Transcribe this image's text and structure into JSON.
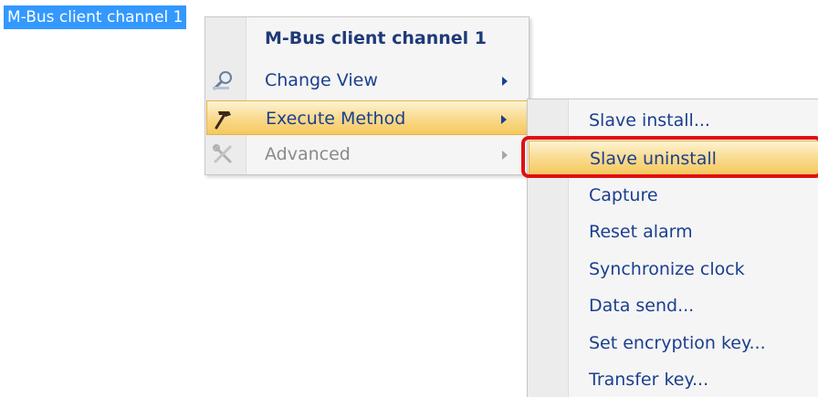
{
  "tree": {
    "selected_item": "M-Bus client channel 1"
  },
  "context_menu": {
    "header": "M-Bus client channel 1",
    "items": [
      {
        "label": "Change View",
        "icon": "magnifier-icon",
        "has_submenu": true,
        "enabled": true
      },
      {
        "label": "Execute Method",
        "icon": "hammer-icon",
        "has_submenu": true,
        "enabled": true,
        "highlighted": true
      },
      {
        "label": "Advanced",
        "icon": "tools-icon",
        "has_submenu": true,
        "enabled": false
      }
    ]
  },
  "submenu": {
    "items": [
      {
        "label": "Slave install..."
      },
      {
        "label": "Slave uninstall",
        "highlighted": true,
        "annotated": true
      },
      {
        "label": "Capture"
      },
      {
        "label": "Reset alarm"
      },
      {
        "label": "Synchronize clock"
      },
      {
        "label": "Data send..."
      },
      {
        "label": "Set encryption key..."
      },
      {
        "label": "Transfer key..."
      }
    ]
  },
  "colors": {
    "selection": "#3399ff",
    "menu_text": "#1a3f8f",
    "highlight": "#f9d98a",
    "annotation": "#e01010"
  }
}
